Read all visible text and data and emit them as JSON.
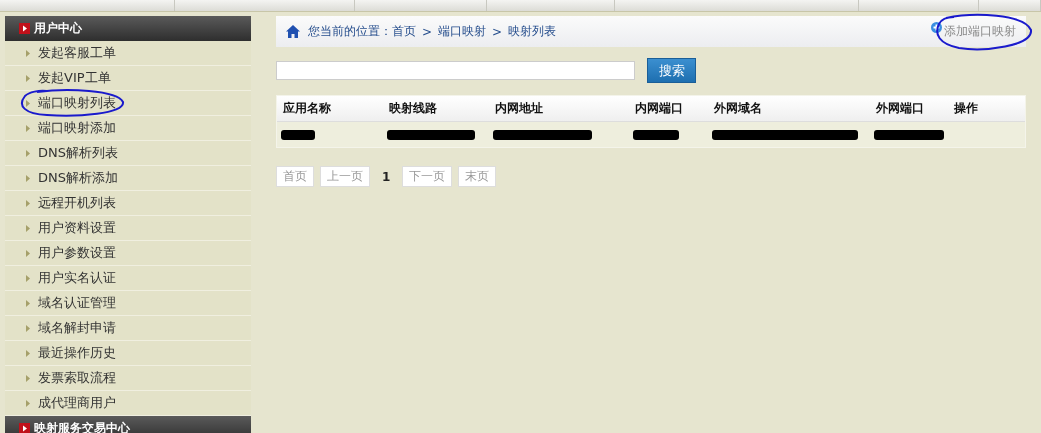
{
  "sidebar": {
    "sections": [
      {
        "title": "用户中心",
        "items": [
          {
            "label": "发起客服工单",
            "circled": false
          },
          {
            "label": "发起VIP工单",
            "circled": false
          },
          {
            "label": "端口映射列表",
            "circled": true
          },
          {
            "label": "端口映射添加",
            "circled": false
          },
          {
            "label": "DNS解析列表",
            "circled": false
          },
          {
            "label": "DNS解析添加",
            "circled": false
          },
          {
            "label": "远程开机列表",
            "circled": false
          },
          {
            "label": "用户资料设置",
            "circled": false
          },
          {
            "label": "用户参数设置",
            "circled": false
          },
          {
            "label": "用户实名认证",
            "circled": false
          },
          {
            "label": "域名认证管理",
            "circled": false
          },
          {
            "label": "域名解封申请",
            "circled": false
          },
          {
            "label": "最近操作历史",
            "circled": false
          },
          {
            "label": "发票索取流程",
            "circled": false
          },
          {
            "label": "成代理商用户",
            "circled": false
          }
        ]
      },
      {
        "title": "映射服务交易中心"
      }
    ]
  },
  "breadcrumb": {
    "prefix": "您当前的位置：",
    "path": [
      "首页",
      "端口映射",
      "映射列表"
    ],
    "separator": ">"
  },
  "add_link": {
    "label": "添加端口映射",
    "circled": true
  },
  "search": {
    "button": "搜索"
  },
  "table": {
    "columns": [
      "应用名称",
      "映射线路",
      "内网地址",
      "内网端口",
      "外网域名",
      "外网端口",
      "操作"
    ],
    "rows": [
      {
        "cells": [
          {
            "redacted": true
          },
          {
            "redacted": true
          },
          {
            "redacted": true
          },
          {
            "redacted": true
          },
          {
            "redacted": true
          },
          {
            "redacted": true
          }
        ]
      }
    ]
  },
  "pagination": [
    {
      "label": "首页",
      "kind": "link"
    },
    {
      "label": "上一页",
      "kind": "link"
    },
    {
      "label": "1",
      "kind": "current"
    },
    {
      "label": "下一页",
      "kind": "link"
    },
    {
      "label": "末页",
      "kind": "link"
    }
  ]
}
